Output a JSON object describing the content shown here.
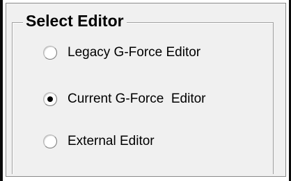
{
  "group": {
    "title": "Select Editor"
  },
  "options": [
    {
      "label": "Legacy G-Force Editor",
      "selected": false
    },
    {
      "label": "Current G-Force  Editor",
      "selected": true
    },
    {
      "label": "External Editor",
      "selected": false
    }
  ]
}
